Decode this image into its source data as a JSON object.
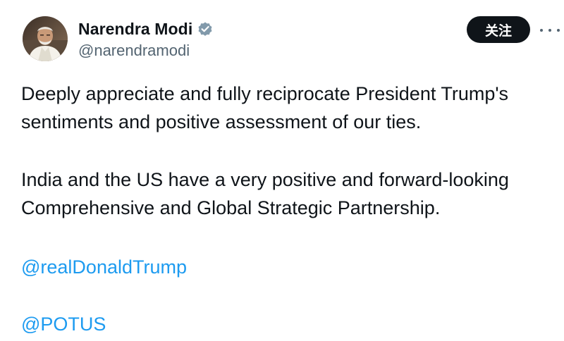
{
  "author": {
    "display_name": "Narendra Modi",
    "handle": "@narendramodi",
    "verified": true,
    "avatar": "profile-photo"
  },
  "actions": {
    "follow_label": "关注",
    "more_icon": "more-horizontal-icon"
  },
  "post": {
    "paragraph1": {
      "line1": "Deeply appreciate and fully reciprocate President Trump's",
      "line2": "sentiments and positive assessment of our ties."
    },
    "paragraph2": {
      "line1": "India and the US have a very positive and forward-looking",
      "line2": "Comprehensive and Global Strategic Partnership."
    },
    "mentions": [
      "@realDonaldTrump",
      "@POTUS"
    ]
  },
  "colors": {
    "text": "#0f1419",
    "secondary": "#536471",
    "link": "#1d9bf0",
    "button_bg": "#0f1419",
    "badge": "#829aab"
  }
}
